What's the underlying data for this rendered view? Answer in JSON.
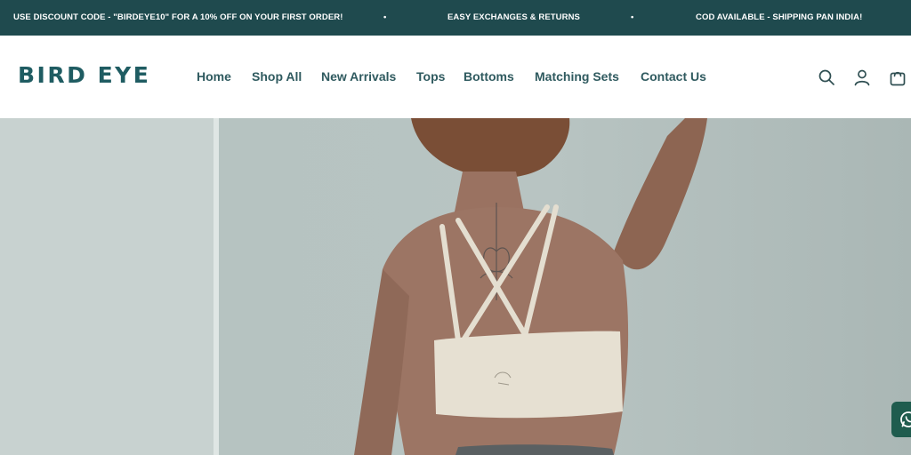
{
  "announcement": {
    "messages": [
      "USE DISCOUNT CODE - \"BIRDEYE10\" FOR A 10% OFF ON YOUR FIRST ORDER!",
      "EASY EXCHANGES & RETURNS",
      "COD AVAILABLE - SHIPPING PAN INDIA!"
    ],
    "separator": "•"
  },
  "header": {
    "logo": "BIRD EYE",
    "nav": [
      "Home",
      "Shop All",
      "New Arrivals",
      "Tops",
      "Bottoms",
      "Matching Sets",
      "Contact Us"
    ],
    "icons": [
      "search-icon",
      "account-icon",
      "cart-icon"
    ]
  },
  "hero": {
    "image": "woman-back-sports-bra-photo"
  },
  "floating": {
    "icon": "whatsapp-icon",
    "color": "#1f5c4e"
  },
  "colors": {
    "announcement_bg": "#1f4a4e",
    "brand": "#1f5c62",
    "nav_text": "#2f5a5f"
  }
}
